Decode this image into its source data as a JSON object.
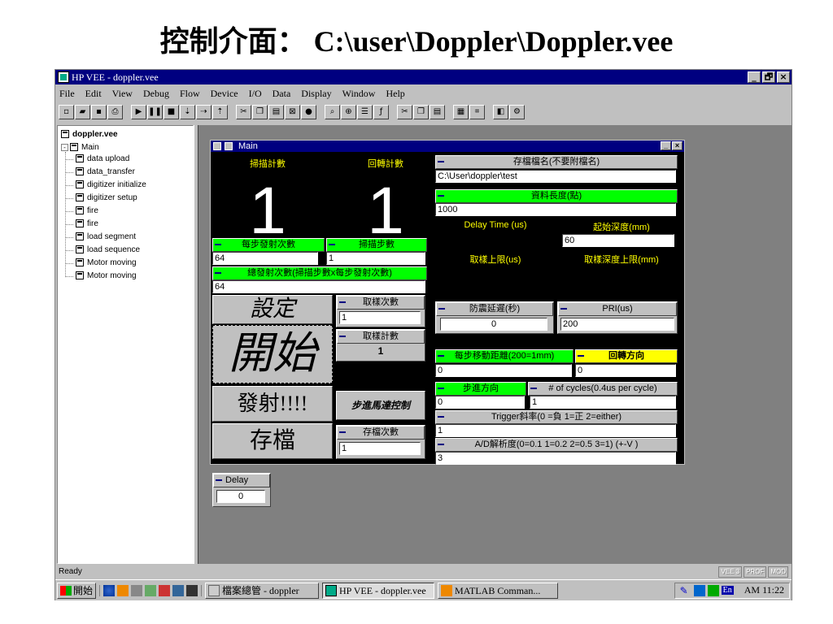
{
  "slide_title": "控制介面： C:\\user\\Doppler\\Doppler.vee",
  "window": {
    "title": "HP VEE - doppler.vee",
    "controls": {
      "min": "_",
      "max": "🗗",
      "close": "×"
    }
  },
  "menu": [
    "File",
    "Edit",
    "View",
    "Debug",
    "Flow",
    "Device",
    "I/O",
    "Data",
    "Display",
    "Window",
    "Help"
  ],
  "toolbar": [
    "new-icon",
    "open-icon",
    "save-icon",
    "print-icon",
    "run-icon",
    "pause-icon",
    "stop-icon",
    "step-into-icon",
    "step-over-icon",
    "step-out-icon",
    "cut-icon",
    "copy-icon",
    "paste-icon",
    "delete-icon",
    "find-icon",
    "zoom-icon",
    "properties-icon",
    "function-icon",
    "cut2-icon",
    "copy2-icon",
    "paste2-icon",
    "bitmap-icon",
    "grid-icon",
    "default-icon",
    "settings-icon"
  ],
  "tree": {
    "root": "doppler.vee",
    "main": "Main",
    "items": [
      "data upload",
      "data_transfer",
      "digitizer initialize",
      "digitizer setup",
      "fire",
      "fire",
      "load segment",
      "load sequence",
      "Motor moving",
      "Motor moving"
    ]
  },
  "status": {
    "text": "Ready",
    "badges": [
      "VEE 3",
      "PROF",
      "MOD"
    ]
  },
  "taskbar": {
    "start": "開始",
    "tasks": [
      "檔案總管 - doppler",
      "HP VEE - doppler.vee",
      "MATLAB Comman..."
    ],
    "tray_en": "En",
    "clock": "AM 11:22"
  },
  "panel": {
    "title": "Main",
    "scan_count_label": "掃描計數",
    "scan_count_value": "1",
    "return_count_label": "回轉計數",
    "return_count_value": "1",
    "fires_per_step_label": "每步發射次數",
    "fires_per_step_value": "64",
    "scan_steps_label": "掃描步數",
    "scan_steps_value": "1",
    "total_fires_label": "總發射次數(掃描步數x每步發射次數)",
    "total_fires_value": "64",
    "btn_setup": "設定",
    "btn_start": "開始",
    "btn_fire": "發射!!!!",
    "btn_save": "存檔",
    "sample_times_label": "取樣次數",
    "sample_times_value": "1",
    "sample_count_label": "取樣計數",
    "sample_count_value": "1",
    "stepper_control_label": "步進馬達控制",
    "save_times_label": "存檔次數",
    "save_times_value": "1",
    "delay_label": "Delay",
    "delay_value": "0",
    "save_filename_label": "存檔檔名(不要附檔名)",
    "save_filename_value": "C:\\User\\doppler\\test",
    "data_length_label": "資料長度(點)",
    "data_length_value": "1000",
    "delay_time_label": "Delay Time (us)",
    "start_depth_label": "起始深度(mm)",
    "start_depth_value": "60",
    "sample_upper_label": "取樣上限(us)",
    "sample_depth_upper_label": "取樣深度上限(mm)",
    "anti_shock_label": "防震延遲(秒)",
    "anti_shock_value": "0",
    "pri_label": "PRI(us)",
    "pri_value": "200",
    "step_distance_label": "每步移動距離(200=1mm)",
    "step_distance_value": "0",
    "return_dir_label": "回轉方向",
    "return_dir_value": "0",
    "step_dir_label": "步進方向",
    "step_dir_value": "0",
    "cycles_label": "# of cycles(0.4us per cycle)",
    "cycles_value": "1",
    "trigger_label": "Trigger斜率(0 =負   1=正   2=either)",
    "trigger_value": "1",
    "ad_res_label": "A/D解析度(0=0.1   1=0.2   2=0.5   3=1) (+-V )",
    "ad_res_value": "3"
  }
}
